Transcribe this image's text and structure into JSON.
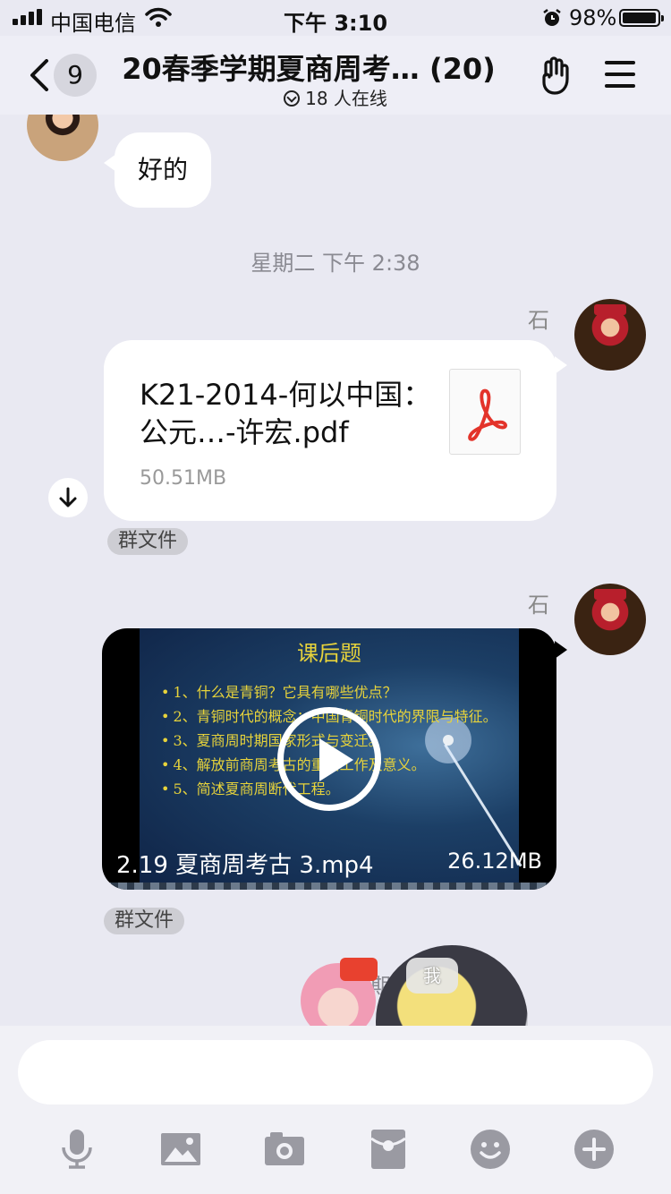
{
  "status_bar": {
    "carrier": "中国电信",
    "time": "下午 3:10",
    "battery_percent": "98%",
    "battery_level": 0.98
  },
  "nav": {
    "unread_count": "9",
    "title": "20春季学期夏商周考… (20)",
    "online_status": "18 人在线"
  },
  "messages": {
    "text_message": "好的",
    "timestamp_1": "星期二 下午 2:38",
    "sender_short": "石",
    "file": {
      "name": "K21-2014-何以中国：公元…-许宏.pdf",
      "size": "50.51MB",
      "tag": "群文件"
    },
    "video": {
      "slide_title": "课后题",
      "slide_lines": [
        "1、什么是青铜？它具有哪些优点？",
        "2、青铜时代的概念；中国青铜时代的界限与特征。",
        "3、夏商周时期国家形式与变迁。",
        "4、解放前商周考古的重要工作及意义。",
        "5、简述夏商周断代工程。"
      ],
      "name": "2.19 夏商周考古 3.mp4",
      "size": "26.12MB",
      "tag": "群文件"
    },
    "timestamp_2": "星期二 下午2:",
    "me_badge": "我"
  },
  "input": {
    "placeholder": ""
  },
  "toolbar": {
    "icons": [
      "microphone-icon",
      "image-icon",
      "camera-icon",
      "red-packet-icon",
      "emoji-icon",
      "plus-icon"
    ]
  },
  "colors": {
    "background": "#e9e9f2",
    "accent_red": "#e3332a",
    "slide_yellow": "#e7d33b"
  }
}
